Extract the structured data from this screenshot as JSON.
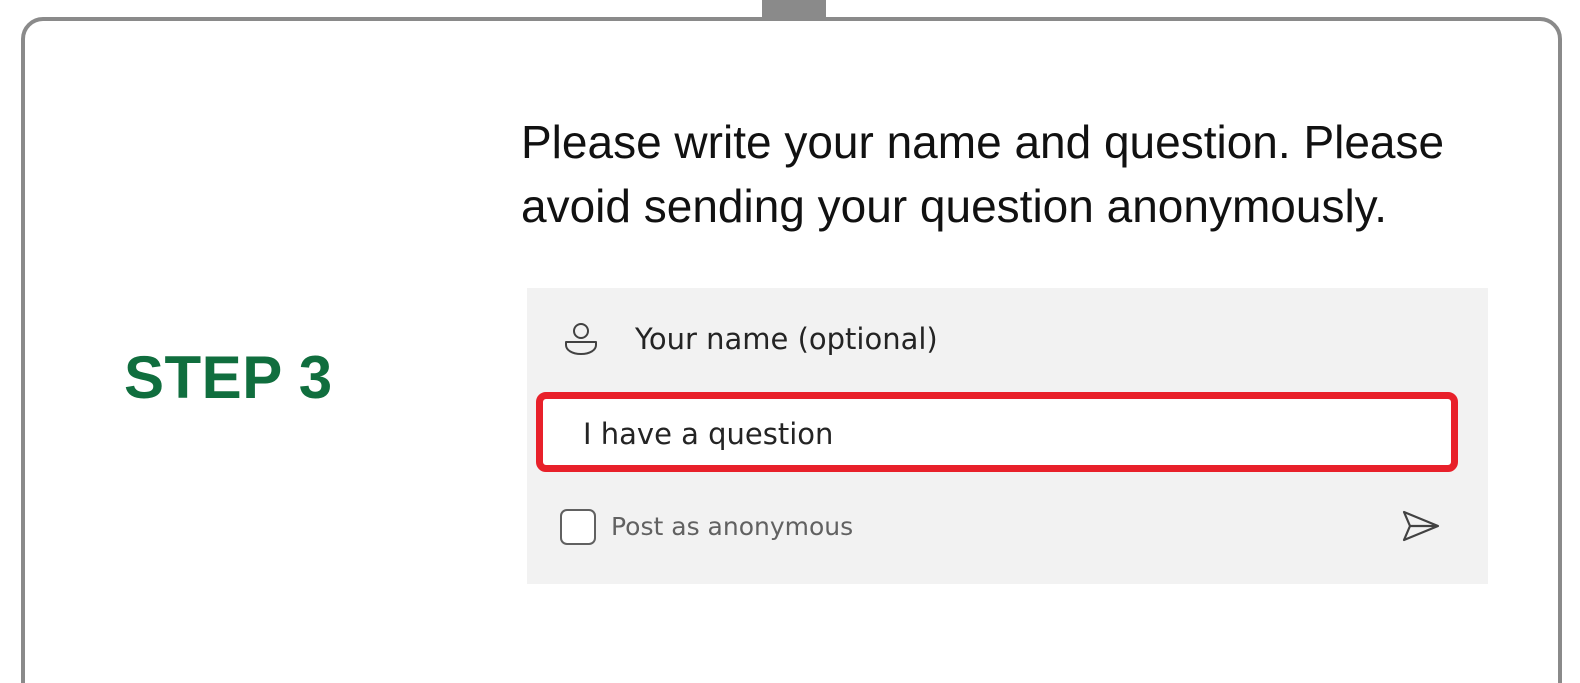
{
  "step": {
    "label": "STEP 3"
  },
  "instruction": {
    "text": "Please write your name and question. Please avoid sending your question anonymously."
  },
  "form": {
    "name_placeholder": "Your name (optional)",
    "name_value": "",
    "question_value": "I have a question",
    "anonymous_label": "Post as anonymous",
    "anonymous_checked": false,
    "icons": {
      "person": "person-icon",
      "send": "send-icon"
    }
  },
  "colors": {
    "step_green": "#106e3e",
    "highlight_red": "#e8202a",
    "frame_gray": "#8a8a8a",
    "panel_gray": "#f2f2f2"
  }
}
